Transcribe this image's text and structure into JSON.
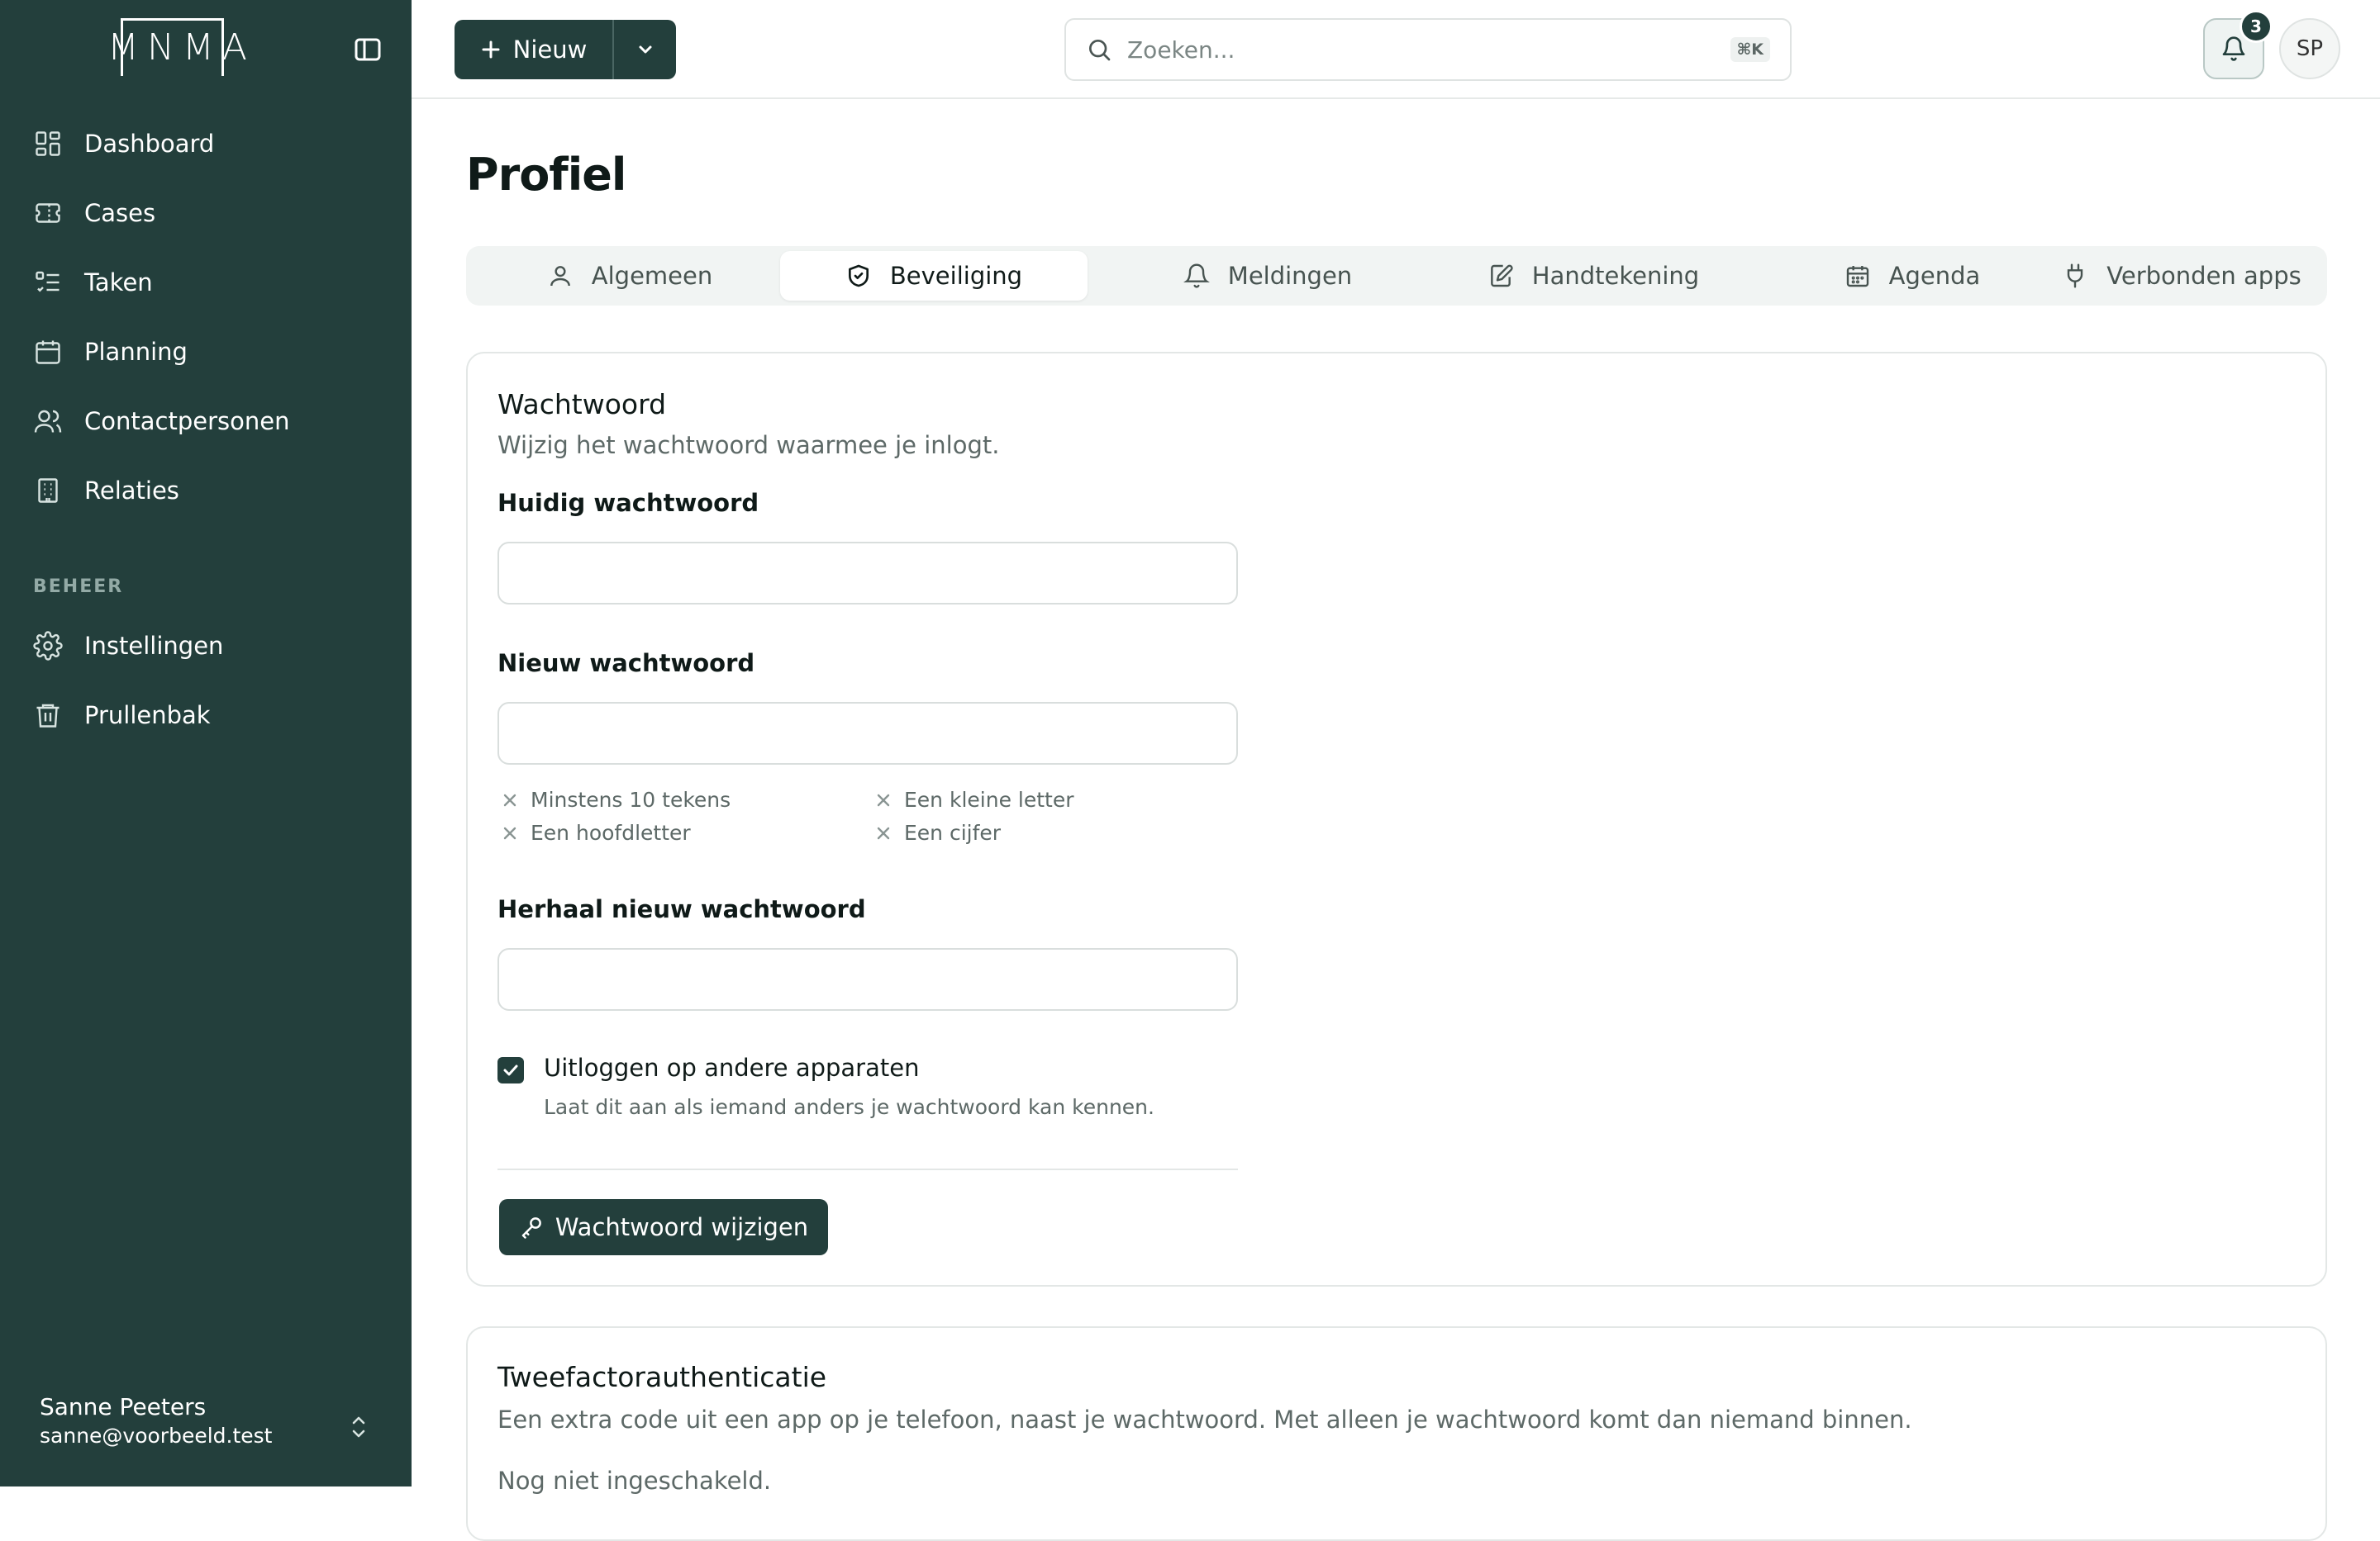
{
  "app": {
    "logo_text": "MNMA"
  },
  "sidebar": {
    "items": [
      {
        "label": "Dashboard",
        "icon": "dashboard-icon"
      },
      {
        "label": "Cases",
        "icon": "ticket-icon"
      },
      {
        "label": "Taken",
        "icon": "task-list-icon"
      },
      {
        "label": "Planning",
        "icon": "calendar-icon"
      },
      {
        "label": "Contactpersonen",
        "icon": "users-icon"
      },
      {
        "label": "Relaties",
        "icon": "building-icon"
      }
    ],
    "section_label": "BEHEER",
    "admin_items": [
      {
        "label": "Instellingen",
        "icon": "gear-icon"
      },
      {
        "label": "Prullenbak",
        "icon": "trash-icon"
      }
    ],
    "user": {
      "name": "Sanne Peeters",
      "email": "sanne@voorbeeld.test"
    }
  },
  "topbar": {
    "new_label": "Nieuw",
    "search_placeholder": "Zoeken...",
    "search_shortcut": "⌘K",
    "notification_count": "3",
    "avatar_initials": "SP"
  },
  "page": {
    "title": "Profiel",
    "tabs": [
      {
        "label": "Algemeen",
        "icon": "user-icon",
        "active": false
      },
      {
        "label": "Beveiliging",
        "icon": "shield-check-icon",
        "active": true
      },
      {
        "label": "Meldingen",
        "icon": "bell-icon",
        "active": false
      },
      {
        "label": "Handtekening",
        "icon": "signature-icon",
        "active": false
      },
      {
        "label": "Agenda",
        "icon": "calendar-icon",
        "active": false
      },
      {
        "label": "Verbonden apps",
        "icon": "plug-icon",
        "active": false
      }
    ]
  },
  "password_card": {
    "title": "Wachtwoord",
    "description": "Wijzig het wachtwoord waarmee je inlogt.",
    "current_label": "Huidig wachtwoord",
    "current_value": "",
    "new_label": "Nieuw wachtwoord",
    "new_value": "",
    "requirements": [
      {
        "label": "Minstens 10 tekens",
        "met": false
      },
      {
        "label": "Een kleine letter",
        "met": false
      },
      {
        "label": "Een hoofdletter",
        "met": false
      },
      {
        "label": "Een cijfer",
        "met": false
      }
    ],
    "repeat_label": "Herhaal nieuw wachtwoord",
    "repeat_value": "",
    "logout_label": "Uitloggen op andere apparaten",
    "logout_checked": true,
    "logout_help": "Laat dit aan als iemand anders je wachtwoord kan kennen.",
    "submit_label": "Wachtwoord wijzigen"
  },
  "twofa_card": {
    "title": "Tweefactorauthenticatie",
    "description": "Een extra code uit een app op je telefoon, naast je wachtwoord. Met alleen je wachtwoord komt dan niemand binnen.",
    "status": "Nog niet ingeschakeld."
  },
  "colors": {
    "brand": "#233f3c",
    "background": "#ffffff",
    "border": "#e3e7e6"
  }
}
